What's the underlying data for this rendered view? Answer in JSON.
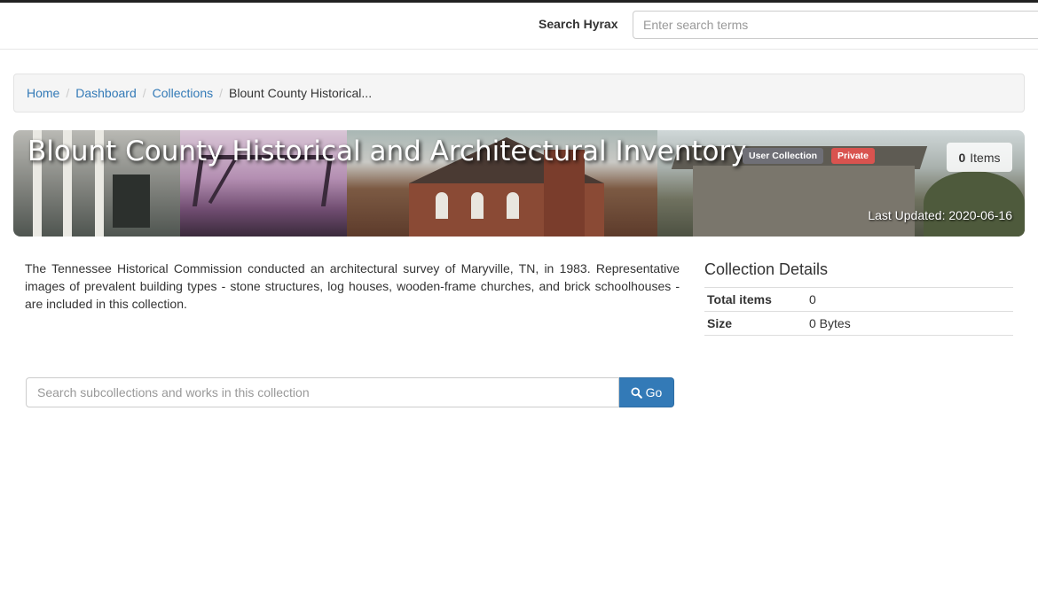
{
  "header": {
    "search_label": "Search Hyrax",
    "search_placeholder": "Enter search terms"
  },
  "breadcrumb": {
    "items": [
      {
        "label": "Home"
      },
      {
        "label": "Dashboard"
      },
      {
        "label": "Collections"
      }
    ],
    "active": "Blount County Historical...",
    "separator": "/"
  },
  "collection": {
    "title": "Blount County Historical and Architectural Inventory",
    "badges": {
      "type": "User Collection",
      "visibility": "Private"
    },
    "item_count": "0",
    "items_label": "Items",
    "last_updated": "Last Updated: 2020-06-16",
    "description": "The Tennessee Historical Commission conducted an architectural survey of Maryville, TN, in 1983. Representative images of prevalent building types - stone structures, log houses, wooden-frame churches, and brick schoolhouses - are included in this collection."
  },
  "details": {
    "heading": "Collection Details",
    "rows": [
      {
        "key": "Total items",
        "value": "0"
      },
      {
        "key": "Size",
        "value": "0 Bytes"
      }
    ]
  },
  "subsearch": {
    "placeholder": "Search subcollections and works in this collection",
    "button_label": "Go"
  },
  "colors": {
    "link": "#337ab7",
    "private_badge": "#d9534f",
    "user_badge": "#6f6f76",
    "button": "#337ab7"
  },
  "icons": {
    "search_button_icon": "search-icon"
  }
}
